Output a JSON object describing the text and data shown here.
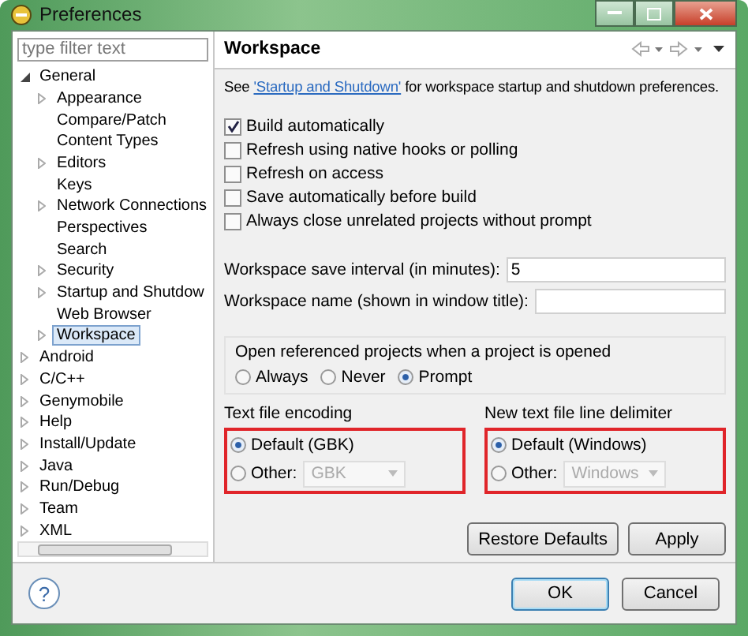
{
  "window": {
    "title": "Preferences"
  },
  "filter": {
    "placeholder": "type filter text"
  },
  "tree": [
    {
      "label": "General",
      "kind": "folder",
      "expanded": true,
      "selected": false,
      "children": [
        {
          "label": "Appearance",
          "kind": "folder",
          "expanded": false,
          "selected": false
        },
        {
          "label": "Compare/Patch",
          "kind": "leaf",
          "selected": false
        },
        {
          "label": "Content Types",
          "kind": "leaf",
          "selected": false
        },
        {
          "label": "Editors",
          "kind": "folder",
          "expanded": false,
          "selected": false
        },
        {
          "label": "Keys",
          "kind": "leaf",
          "selected": false
        },
        {
          "label": "Network Connections",
          "kind": "folder",
          "expanded": false,
          "selected": false
        },
        {
          "label": "Perspectives",
          "kind": "leaf",
          "selected": false
        },
        {
          "label": "Search",
          "kind": "leaf",
          "selected": false
        },
        {
          "label": "Security",
          "kind": "folder",
          "expanded": false,
          "selected": false
        },
        {
          "label": "Startup and Shutdow",
          "kind": "folder",
          "expanded": false,
          "selected": false
        },
        {
          "label": "Web Browser",
          "kind": "leaf",
          "selected": false
        },
        {
          "label": "Workspace",
          "kind": "folder",
          "expanded": false,
          "selected": true
        }
      ]
    },
    {
      "label": "Android",
      "kind": "folder",
      "expanded": false,
      "selected": false
    },
    {
      "label": "C/C++",
      "kind": "folder",
      "expanded": false,
      "selected": false
    },
    {
      "label": "Genymobile",
      "kind": "folder",
      "expanded": false,
      "selected": false
    },
    {
      "label": "Help",
      "kind": "folder",
      "expanded": false,
      "selected": false
    },
    {
      "label": "Install/Update",
      "kind": "folder",
      "expanded": false,
      "selected": false
    },
    {
      "label": "Java",
      "kind": "folder",
      "expanded": false,
      "selected": false
    },
    {
      "label": "Run/Debug",
      "kind": "folder",
      "expanded": false,
      "selected": false
    },
    {
      "label": "Team",
      "kind": "folder",
      "expanded": false,
      "selected": false
    },
    {
      "label": "XML",
      "kind": "folder",
      "expanded": false,
      "selected": false
    }
  ],
  "page": {
    "title": "Workspace",
    "intro_before": "See ",
    "intro_link": "'Startup and Shutdown'",
    "intro_after": " for workspace startup and shutdown preferences.",
    "checkboxes": [
      {
        "label": "Build automatically",
        "checked": true
      },
      {
        "label": "Refresh using native hooks or polling",
        "checked": false
      },
      {
        "label": "Refresh on access",
        "checked": false
      },
      {
        "label": "Save automatically before build",
        "checked": false
      },
      {
        "label": "Always close unrelated projects without prompt",
        "checked": false
      }
    ],
    "fields": [
      {
        "label": "Workspace save interval (in minutes):",
        "value": "5"
      },
      {
        "label": "Workspace name (shown in window title):"
      }
    ],
    "open_referenced": {
      "title": "Open referenced projects when a project is opened",
      "options": [
        {
          "label": "Always",
          "selected": false
        },
        {
          "label": "Never",
          "selected": false
        },
        {
          "label": "Prompt",
          "selected": true
        }
      ]
    },
    "groups": [
      {
        "title": "Text file encoding",
        "highlighted": true,
        "default": {
          "label": "Default (GBK)",
          "selected": true
        },
        "other": {
          "label": "Other:",
          "selected": false,
          "value": "GBK",
          "disabled": true
        }
      },
      {
        "title": "New text file line delimiter",
        "highlighted": true,
        "default": {
          "label": "Default (Windows)",
          "selected": true
        },
        "other": {
          "label": "Other:",
          "selected": false,
          "value": "Windows",
          "disabled": true
        }
      }
    ],
    "buttons": [
      "Restore Defaults",
      "Apply"
    ]
  },
  "footer": {
    "help": "?",
    "buttons": [
      {
        "label": "OK",
        "default": true
      },
      {
        "label": "Cancel",
        "default": false
      }
    ]
  }
}
